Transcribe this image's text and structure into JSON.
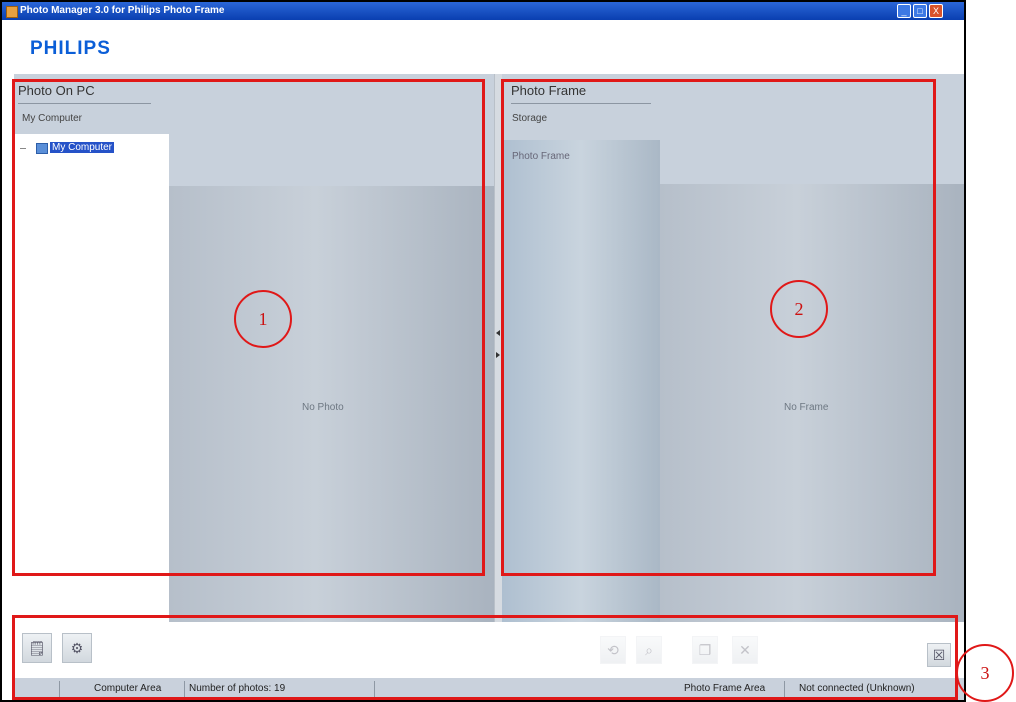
{
  "window": {
    "title": "Photo Manager 3.0 for Philips Photo Frame",
    "buttons": [
      "_",
      "□",
      "X"
    ]
  },
  "brand": {
    "logo": "PHILIPS",
    "color": "#0b5ed7"
  },
  "left_panel": {
    "title": "Photo On PC",
    "subtitle": "My Computer",
    "tree": [
      {
        "label": "My Computer",
        "selected": true
      }
    ],
    "placeholder": "No Photo"
  },
  "right_panel": {
    "title": "Photo Frame",
    "subtitle": "Storage",
    "items": [
      "Photo Frame"
    ],
    "placeholder": "No Frame"
  },
  "annotations": {
    "labels": [
      "1",
      "2",
      "3"
    ],
    "color": "#e01818"
  },
  "toolbar": {
    "left_buttons": [
      {
        "name": "import-photo-button",
        "icon": "document-icon",
        "glyph": "🗒"
      },
      {
        "name": "settings-button",
        "icon": "gear-icon",
        "glyph": "⚙"
      }
    ],
    "center_buttons": [
      {
        "name": "rotate-button",
        "icon": "rotate-icon",
        "glyph": "⟲",
        "enabled": false
      },
      {
        "name": "zoom-button",
        "icon": "zoom-icon",
        "glyph": "⌕",
        "enabled": false
      },
      {
        "name": "copy-button",
        "icon": "copy-icon",
        "glyph": "❐",
        "enabled": false
      },
      {
        "name": "delete-button",
        "icon": "delete-icon",
        "glyph": "✕",
        "enabled": false
      }
    ],
    "close_glyph": "☒"
  },
  "status": {
    "computer_area": "Computer Area",
    "photo_count": "Number of photos: 19",
    "frame_area": "Photo Frame Area",
    "frame_status": "Not connected (Unknown)"
  }
}
